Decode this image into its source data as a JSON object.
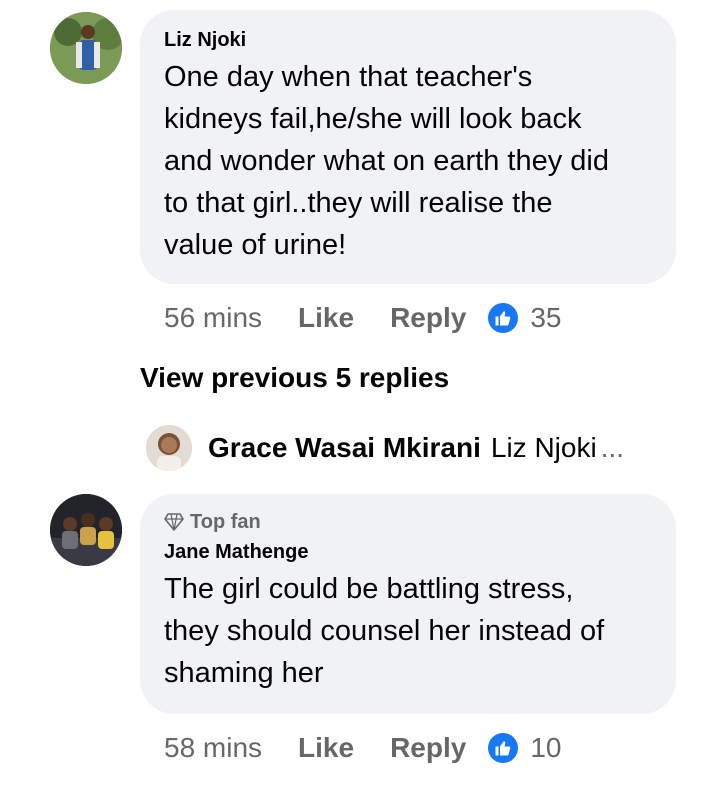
{
  "comments": [
    {
      "author": "Liz Njoki",
      "text_lines": [
        "One day when that teacher's",
        "kidneys fail,he/she will look back",
        "and wonder what on earth they did",
        "to that girl..they will realise the",
        "value of urine!"
      ],
      "time": "56 mins",
      "like_label": "Like",
      "reply_label": "Reply",
      "reaction_count": "35"
    },
    {
      "badge": "Top fan",
      "author": "Jane Mathenge",
      "text_lines": [
        "The girl could be battling stress,",
        "they should counsel her instead of",
        "shaming her"
      ],
      "time": "58 mins",
      "like_label": "Like",
      "reply_label": "Reply",
      "reaction_count": "10"
    }
  ],
  "view_previous": "View previous 5 replies",
  "reply_preview": {
    "author": "Grace Wasai Mkirani",
    "mention": "Liz Njoki",
    "ellipsis": "..."
  },
  "colors": {
    "bubble": "#f0f2f5",
    "meta_text": "#65676b",
    "like_blue": "#1877f2"
  },
  "icons": [
    "like-icon",
    "diamond-icon"
  ]
}
